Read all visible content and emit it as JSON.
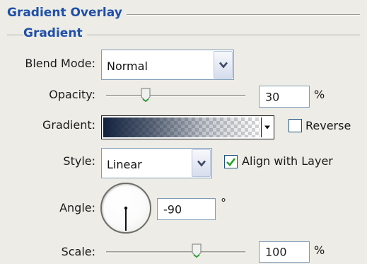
{
  "sections": {
    "outer_title": "Gradient Overlay",
    "inner_title": "Gradient"
  },
  "blend_mode": {
    "label": "Blend Mode:",
    "value": "Normal"
  },
  "opacity": {
    "label": "Opacity:",
    "value": "30",
    "unit": "%",
    "slider_fraction": 0.3
  },
  "gradient": {
    "label": "Gradient:",
    "start_color": "#12223e",
    "end_color": "transparent"
  },
  "reverse": {
    "label": "Reverse",
    "checked": false
  },
  "style": {
    "label": "Style:",
    "value": "Linear"
  },
  "align_with_layer": {
    "label": "Align with Layer",
    "checked": true
  },
  "angle": {
    "label": "Angle:",
    "value": "-90",
    "unit": "°",
    "degrees": -90
  },
  "scale": {
    "label": "Scale:",
    "value": "100",
    "unit": "%",
    "slider_fraction": 0.65
  },
  "colors": {
    "section_title": "#1f4fa8",
    "checkmark": "#21a121",
    "input_border": "#7f9db9",
    "panel_background": "#edece6"
  },
  "icons": {
    "dropdown": "chevron-down-icon",
    "slider_thumb": "slider-thumb-icon",
    "checkmark": "check-icon"
  }
}
